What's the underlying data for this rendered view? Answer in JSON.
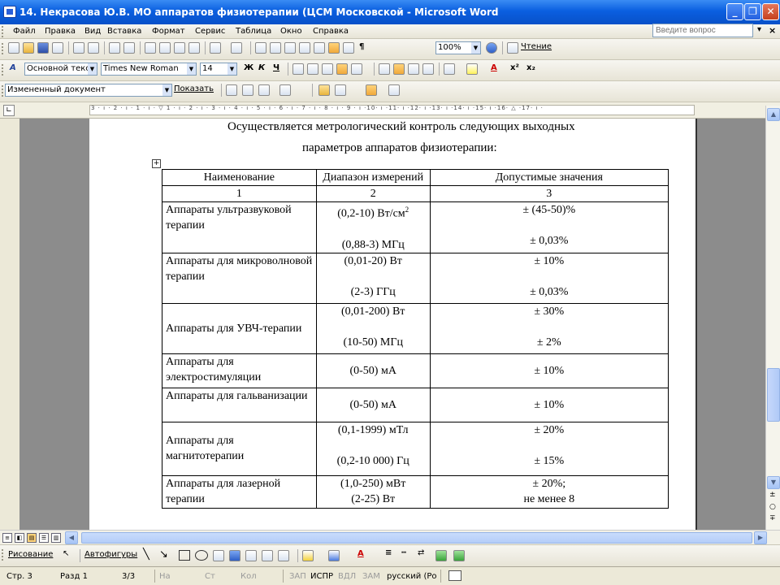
{
  "window": {
    "title": "14. Некрасова Ю.В. МО аппаратов физиотерапии (ЦСМ Московской - Microsoft Word"
  },
  "menu": {
    "items": [
      "Файл",
      "Правка",
      "Вид",
      "Вставка",
      "Формат",
      "Сервис",
      "Таблица",
      "Окно",
      "Справка"
    ],
    "ask_placeholder": "Введите вопрос"
  },
  "toolbar_standard": {
    "zoom": "100%",
    "reading_label": "Чтение"
  },
  "toolbar_format": {
    "style": "Основной текст",
    "font": "Times New Roman",
    "size": "14"
  },
  "toolbar_review": {
    "state": "Измененный документ",
    "show_label": "Показать"
  },
  "ruler": {
    "ticks": "3 · ı · 2 · ı · 1 · ı · ▽ 1 · ı · 2 · ı · 3 · ı · 4 · ı · 5 · ı · 6 · ı · 7 · ı · 8 · ı · 9 · ı ·10· ı ·11· ı ·12· ı ·13· ı ·14· ı ·15· ı ·16· △ ·17· ı ·"
  },
  "document": {
    "intro_line1": "Осуществляется метрологический контроль следующих выходных",
    "intro_line2": "параметров аппаратов физиотерапии:",
    "table": {
      "headers": {
        "name": "Наименование",
        "range": "Диапазон измерений",
        "allowed": "Допустимые значения"
      },
      "numbers": [
        "1",
        "2",
        "3"
      ],
      "rows": [
        {
          "name": "Аппараты ультразвуковой терапии",
          "range1": "(0,2-10) Вт/см",
          "range1_sup": "2",
          "range2": "(0,88-3) МГц",
          "allowed1": "± (45-50)%",
          "allowed2": "± 0,03%"
        },
        {
          "name": "Аппараты для микроволновой терапии",
          "range1": "(0,01-20) Вт",
          "range2": "(2-3) ГГц",
          "allowed1": "± 10%",
          "allowed2": "± 0,03%"
        },
        {
          "name": "Аппараты для УВЧ-терапии",
          "range1": "(0,01-200) Вт",
          "range2": "(10-50) МГц",
          "allowed1": "± 30%",
          "allowed2": "± 2%"
        },
        {
          "name": "Аппараты для электростимуляции",
          "range1": "(0-50) мА",
          "allowed1": "± 10%"
        },
        {
          "name": "Аппараты для гальванизации",
          "range1": "(0-50) мА",
          "allowed1": "± 10%"
        },
        {
          "name": "Аппараты для магнитотерапии",
          "range1": "(0,1-1999) мТл",
          "range2": "(0,2-10 000) Гц",
          "allowed1": "± 20%",
          "allowed2": "± 15%"
        },
        {
          "name": "Аппараты для лазерной терапии",
          "range1": "(1,0-250) мВт",
          "range2": "(2-25) Вт",
          "allowed1": "± 20%;",
          "allowed2": "не менее 8"
        }
      ]
    }
  },
  "drawing_toolbar": {
    "drawing_label": "Рисование",
    "autoshapes_label": "Автофигуры"
  },
  "status": {
    "page": "Стр. 3",
    "section": "Разд 1",
    "pages": "3/3",
    "at": "На",
    "line": "Ст",
    "col": "Кол",
    "rec": "ЗАП",
    "trk": "ИСПР",
    "ext": "ВДЛ",
    "ovr": "ЗАМ",
    "lang": "русский (Ро"
  }
}
